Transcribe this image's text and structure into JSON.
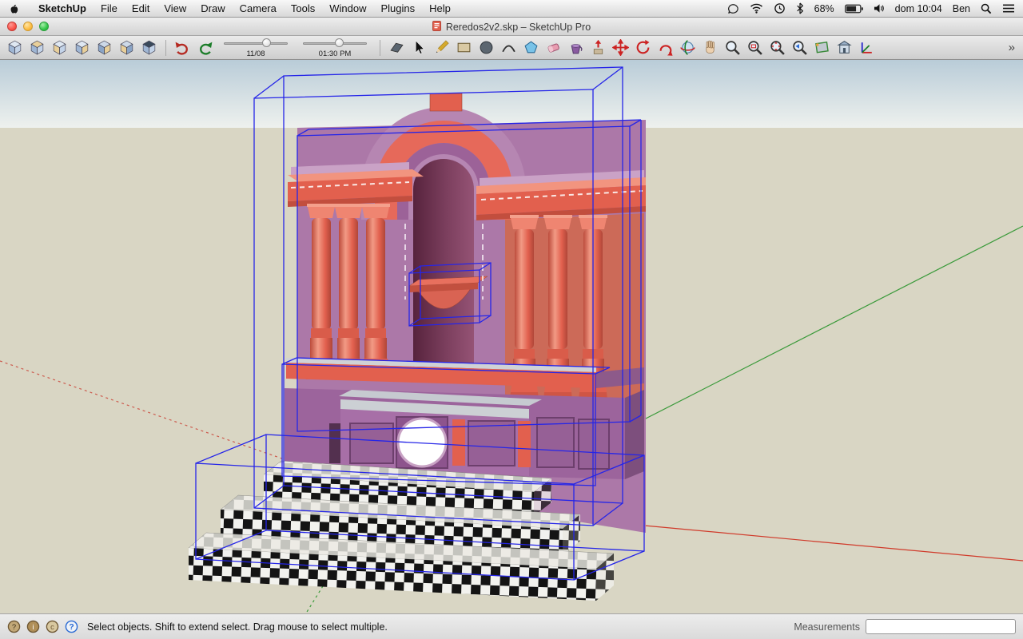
{
  "menubar": {
    "app_name": "SketchUp",
    "items": [
      "File",
      "Edit",
      "View",
      "Draw",
      "Camera",
      "Tools",
      "Window",
      "Plugins",
      "Help"
    ],
    "status": {
      "battery_percent": "68%",
      "clock": "dom 10:04",
      "user": "Ben"
    }
  },
  "window": {
    "title": "Reredos2v2.skp – SketchUp Pro"
  },
  "toolbar": {
    "shadow_date": "11/08",
    "shadow_time": "01:30 PM",
    "overflow": "»",
    "tools": [
      "iso-view",
      "top-view",
      "front-view",
      "right-view",
      "back-view",
      "left-view",
      "bottom-view",
      "undo",
      "redo",
      "shadow-date-slider",
      "shadow-time-slider",
      "make-component",
      "select",
      "line",
      "rectangle",
      "circle",
      "arc",
      "polygon",
      "eraser",
      "paint-bucket",
      "push-pull",
      "move",
      "rotate",
      "follow-me",
      "orbit",
      "pan",
      "zoom",
      "zoom-window",
      "zoom-extents",
      "previous-view",
      "section-plane",
      "get-models",
      "axes"
    ]
  },
  "viewport": {
    "model_name": "reredos-altar-model",
    "colors": {
      "sky": "#b9ccd8",
      "ground": "#d9d6c4",
      "selection_blue": "#2525e8",
      "axis_red": "#d03a2a",
      "axis_green": "#3a9a3a",
      "model_purple": "#ac78a8",
      "model_salmon": "#e2604e"
    }
  },
  "statusbar": {
    "hint": "Select objects. Shift to extend select. Drag mouse to select multiple.",
    "measurements_label": "Measurements",
    "measurements_value": ""
  }
}
